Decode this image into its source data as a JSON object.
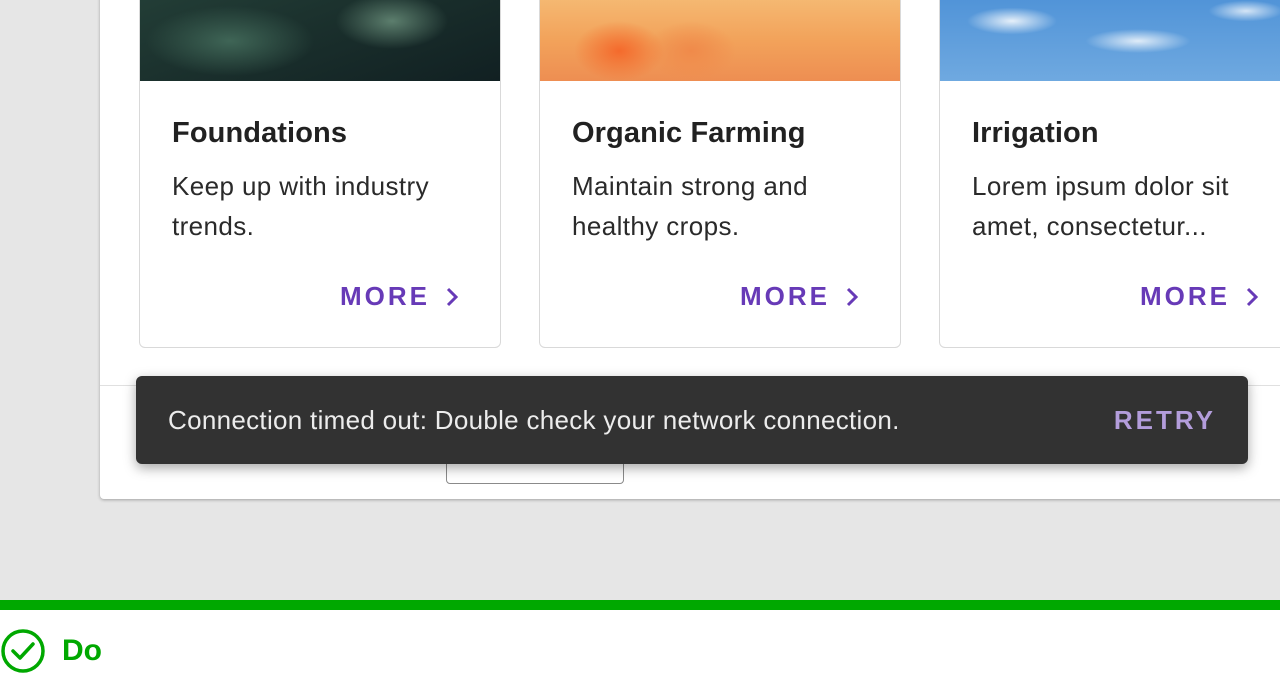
{
  "cards": [
    {
      "title": "Foundations",
      "description": "Keep up with industry trends.",
      "action_label": "MORE",
      "action_icon": "chevron-right-icon"
    },
    {
      "title": "Organic Farming",
      "description": "Maintain strong and healthy crops.",
      "action_label": "MORE",
      "action_icon": "chevron-right-icon"
    },
    {
      "title": "Irrigation",
      "description": "Lorem ipsum dolor sit amet, consectetur...",
      "action_label": "MORE",
      "action_icon": "chevron-right-icon"
    }
  ],
  "snackbar": {
    "message": "Connection timed out: Double check your network connection.",
    "action_label": "RETRY"
  },
  "guideline": {
    "label": "Do",
    "icon": "check-circle-icon"
  },
  "colors": {
    "accent": "#673ab7",
    "snackbar_background": "#323232",
    "snackbar_action": "#b39ddb",
    "guideline_green": "#00a800",
    "canvas_background": "#e6e6e6"
  }
}
